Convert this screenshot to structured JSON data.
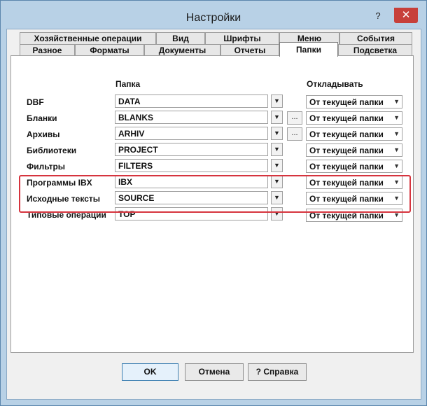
{
  "window": {
    "title": "Настройки",
    "close_glyph": "✕",
    "help_glyph": "?"
  },
  "tabs_back": [
    "Хозяйственные операции",
    "Вид",
    "Шрифты",
    "Меню",
    "События"
  ],
  "tabs_front": [
    "Разное",
    "Форматы",
    "Документы",
    "Отчеты",
    "Папки",
    "Подсветка"
  ],
  "active_tab": "Папки",
  "headers": {
    "folder": "Папка",
    "defer": "Откладывать"
  },
  "rows": [
    {
      "label": "DBF",
      "value": "DATA",
      "browse": false,
      "defer": "От текущей папки"
    },
    {
      "label": "Бланки",
      "value": "BLANKS",
      "browse": true,
      "defer": "От текущей папки"
    },
    {
      "label": "Архивы",
      "value": "ARHIV",
      "browse": true,
      "defer": "От текущей папки"
    },
    {
      "label": "Библиотеки",
      "value": "PROJECT",
      "browse": false,
      "defer": "От текущей папки"
    },
    {
      "label": "Фильтры",
      "value": "FILTERS",
      "browse": false,
      "defer": "От текущей папки"
    },
    {
      "label": "Программы IBX",
      "value": "IBX",
      "browse": false,
      "defer": "От текущей папки"
    },
    {
      "label": "Исходные тексты",
      "value": "SOURCE",
      "browse": false,
      "defer": "От текущей папки"
    },
    {
      "label": "Типовые операции",
      "value": "TOP",
      "browse": false,
      "defer": "От текущей папки"
    }
  ],
  "glyphs": {
    "dropdown": "▼",
    "browse": "..."
  },
  "buttons": {
    "ok": "OK",
    "cancel": "Отмена",
    "help": "? Справка"
  },
  "colors": {
    "highlight": "#d6343e",
    "close": "#c7403a"
  }
}
